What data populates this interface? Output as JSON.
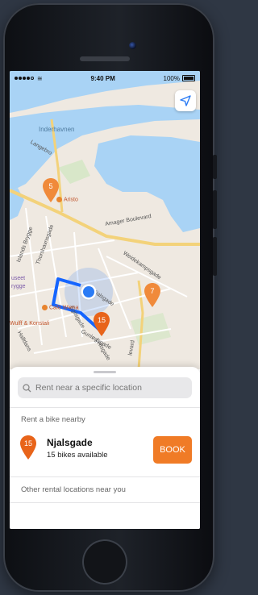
{
  "status_bar": {
    "time": "9:40 PM",
    "battery": "100%"
  },
  "map": {
    "labels": {
      "inderhavnen": "Inderhavnen",
      "langebro": "Langebro",
      "amager": "Amager Boulevard",
      "islands_brygge": "Islands Brygge",
      "thorshavnsgade": "Thorshavnsgade",
      "weidekampsgade": "Weidekampsgade",
      "njalsgade": "Njalsgade",
      "egilsgade": "Egilsgade",
      "halfdans": "Halfdans",
      "museet": "useet",
      "brygge": "rygge",
      "gunloegsgade": "Gunløgsgade",
      "leifsgade": "Leifsgade",
      "boulevard": "levard"
    },
    "pois": {
      "aristo": "Aristo",
      "cafe_wiena": "Café Wiena",
      "wulff": "Wulff & Konstali"
    },
    "pins": [
      {
        "name": "pin-5",
        "count": "5"
      },
      {
        "name": "pin-7",
        "count": "7"
      },
      {
        "name": "pin-15",
        "count": "15"
      }
    ],
    "icons": {
      "locate": "location-arrow-icon",
      "user": "user-location-icon"
    },
    "colors": {
      "accent": "#f07b26",
      "water": "#a9d3f5",
      "land": "#efe9e1",
      "road": "#f3d27a",
      "route": "#1565ff",
      "user": "#2a7bf5"
    }
  },
  "sheet": {
    "search_placeholder": "Rent near a specific location",
    "nearby_title": "Rent a bike nearby",
    "station": {
      "count": "15",
      "name": "Njalsgade",
      "availability": "15 bikes available",
      "book_label": "BOOK"
    },
    "other_title": "Other rental locations near you"
  }
}
